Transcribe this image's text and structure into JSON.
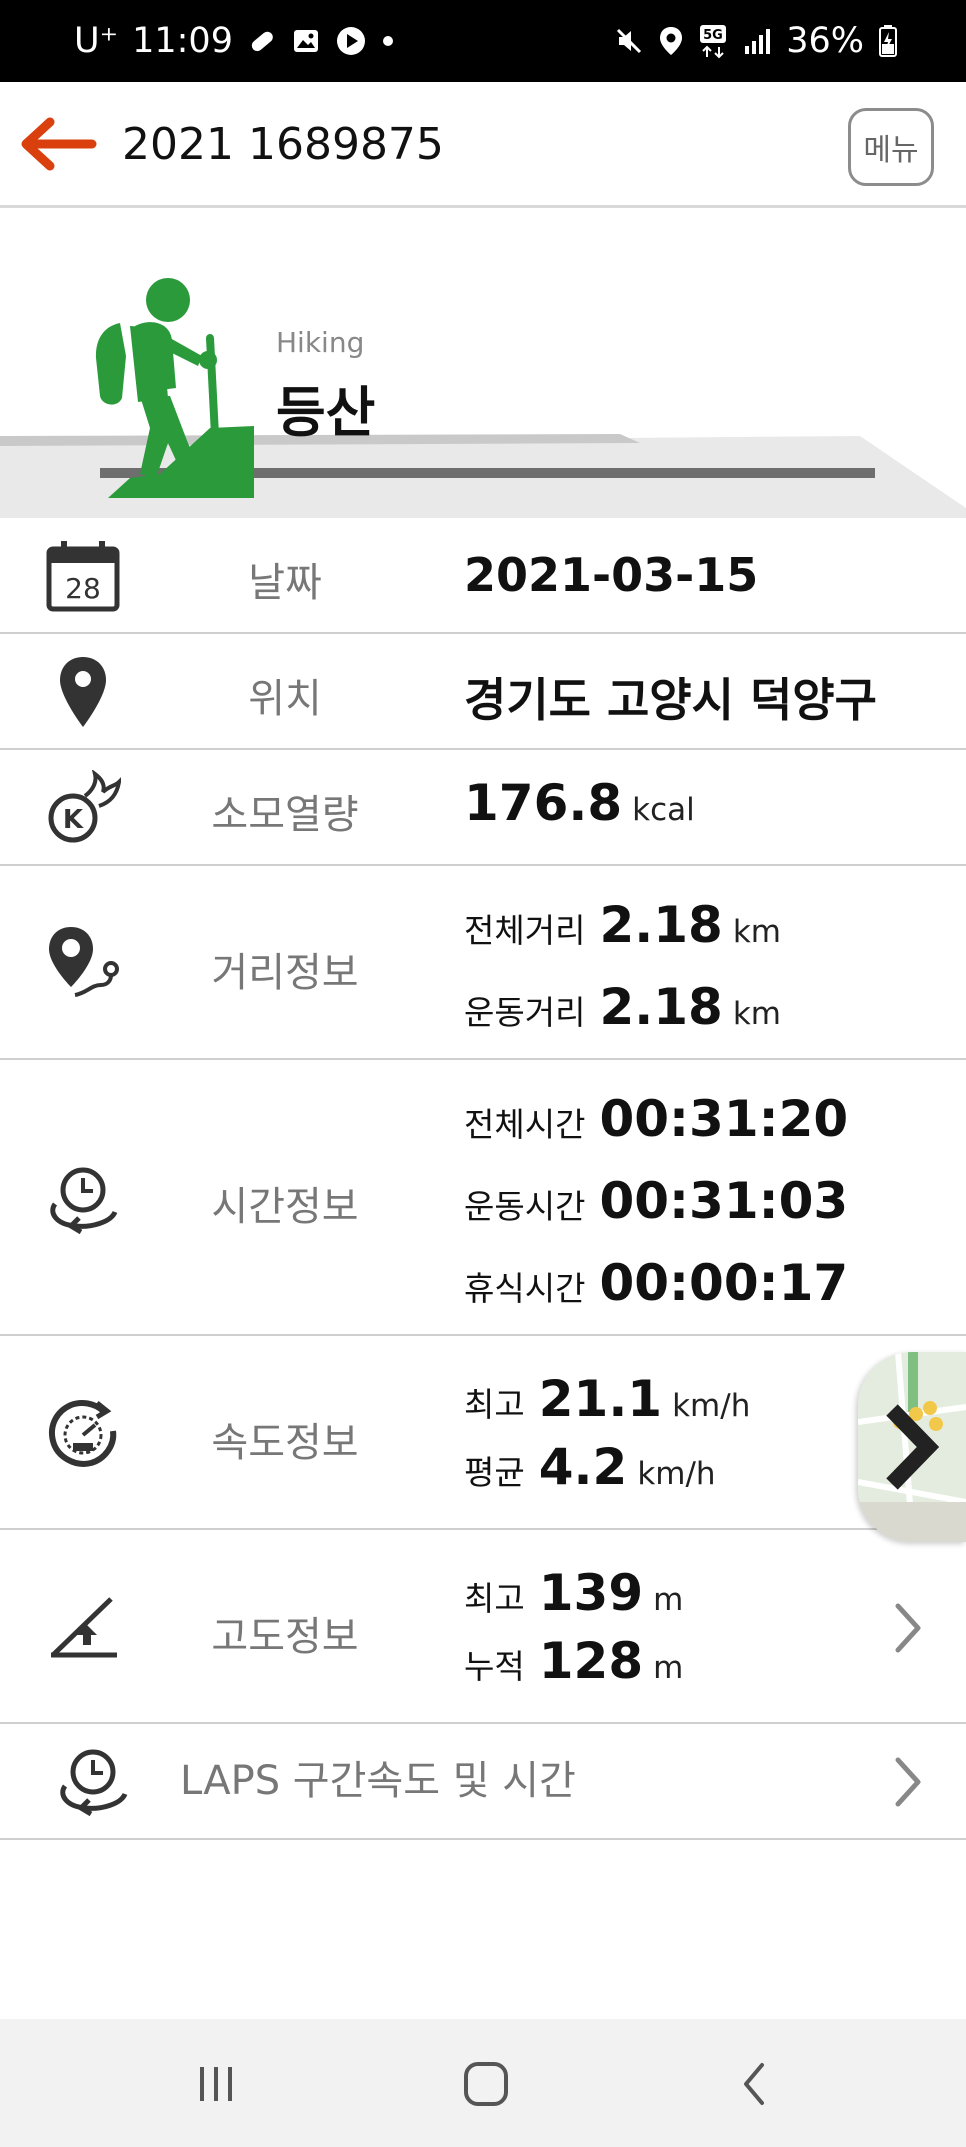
{
  "status_bar": {
    "carrier": "U⁺",
    "time": "11:09",
    "battery": "36%",
    "network": "5G"
  },
  "header": {
    "title": "2021 1689875",
    "menu_label": "메뉴",
    "accent_color": "#d9400e"
  },
  "activity": {
    "subtitle": "Hiking",
    "title": "등산",
    "icon": "hiker-icon",
    "icon_color": "#2a9a3a"
  },
  "rows": {
    "date": {
      "label": "날짜",
      "value": "2021-03-15",
      "icon_text": "28"
    },
    "location": {
      "label": "위치",
      "value": "경기도 고양시 덕양구"
    },
    "calories": {
      "label": "소모열량",
      "value": "176.8",
      "unit": "kcal"
    },
    "distance": {
      "label": "거리정보",
      "total_key": "전체거리",
      "total_value": "2.18",
      "total_unit": "km",
      "moving_key": "운동거리",
      "moving_value": "2.18",
      "moving_unit": "km"
    },
    "time": {
      "label": "시간정보",
      "total_key": "전체시간",
      "total_value": "00:31:20",
      "moving_key": "운동시간",
      "moving_value": "00:31:03",
      "rest_key": "휴식시간",
      "rest_value": "00:00:17"
    },
    "speed": {
      "label": "속도정보",
      "max_key": "최고",
      "max_value": "21.1",
      "max_unit": "km/h",
      "avg_key": "평균",
      "avg_value": "4.2",
      "avg_unit": "km/h"
    },
    "altitude": {
      "label": "고도정보",
      "max_key": "최고",
      "max_value": "139",
      "max_unit": "m",
      "cum_key": "누적",
      "cum_value": "128",
      "cum_unit": "m"
    },
    "laps": {
      "label": "LAPS 구간속도 및 시간"
    }
  }
}
